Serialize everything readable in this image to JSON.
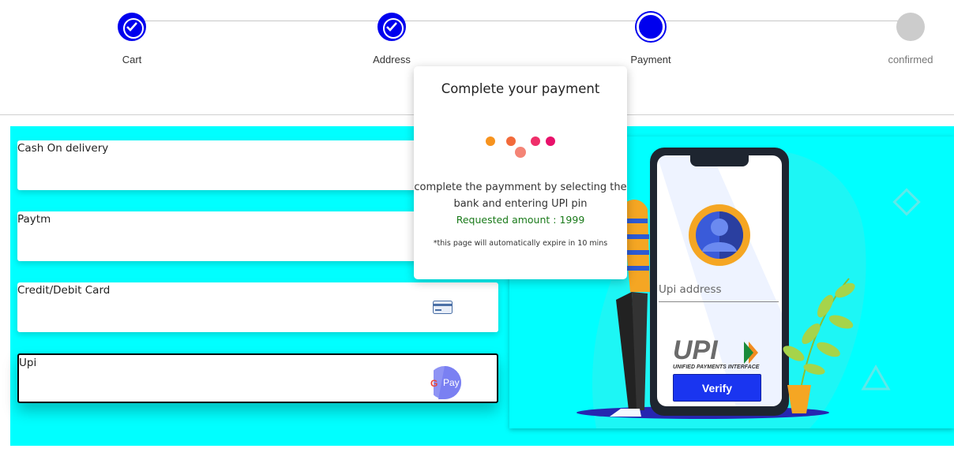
{
  "stepper": {
    "steps": [
      {
        "label": "Cart",
        "state": "done"
      },
      {
        "label": "Address",
        "state": "done"
      },
      {
        "label": "Payment",
        "state": "active"
      },
      {
        "label": "confirmed",
        "state": "pending"
      }
    ]
  },
  "payment_options": [
    {
      "label": "Cash On delivery",
      "icon": null
    },
    {
      "label": "Paytm",
      "icon": null
    },
    {
      "label": "Credit/Debit Card",
      "icon": "credit-card-icon"
    },
    {
      "label": "Upi",
      "icon": "gpay-icon",
      "selected": true
    }
  ],
  "gpay_text": "Pay",
  "upi_form": {
    "placeholder": "Upi address",
    "logo_text": "UPI",
    "logo_subtext": "UNIFIED PAYMENTS INTERFACE",
    "verify_label": "Verify"
  },
  "modal": {
    "title": "Complete your payment",
    "message": "complete the paymment by selecting the bank and entering UPI pin",
    "amount_text": "Requested amount : 1999",
    "note": "*this page will automatically expire in 10 mins"
  },
  "colors": {
    "accent": "#0000ee",
    "panel_bg": "#00ffff",
    "verify_bg": "#1a35f0",
    "amount_text": "#1a7a1a"
  }
}
